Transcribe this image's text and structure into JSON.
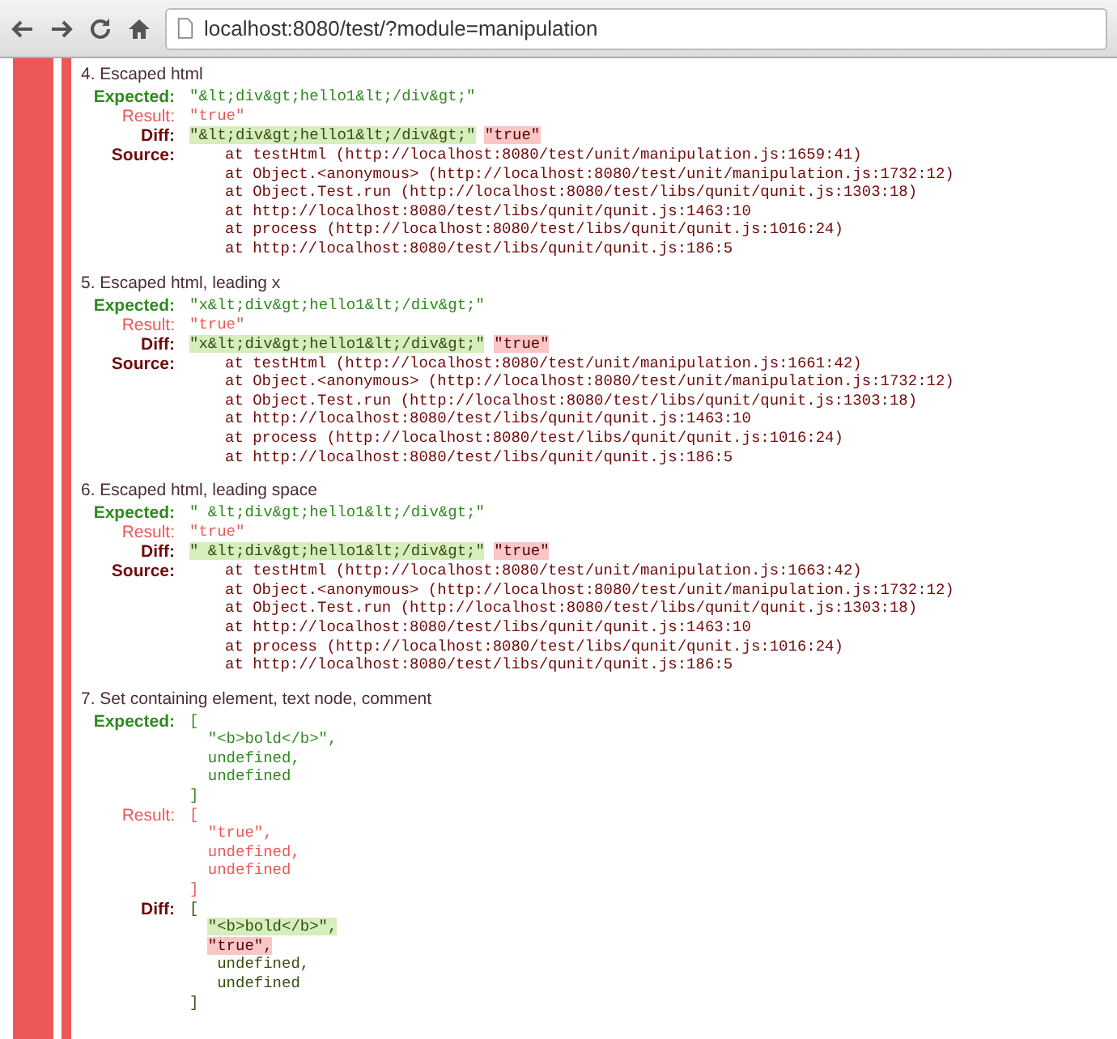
{
  "browser": {
    "url": "localhost:8080/test/?module=manipulation"
  },
  "module": {
    "failed": true
  },
  "tests": [
    {
      "title": "4. Escaped html",
      "rows": [
        {
          "kind": "expected",
          "label": "Expected:",
          "lines": [
            "\"&lt;div&gt;hello1&lt;/div&gt;\""
          ]
        },
        {
          "kind": "result",
          "label": "Result:",
          "lines": [
            "\"true\""
          ]
        },
        {
          "kind": "diff",
          "label": "Diff:",
          "diff": [
            [
              {
                "kind": "ins",
                "text": "\"&lt;div&gt;hello1&lt;/div&gt;\""
              },
              {
                "kind": "del",
                "text": "\"true\""
              }
            ]
          ]
        },
        {
          "kind": "source",
          "label": "Source:",
          "lines": [
            "at testHtml (http://localhost:8080/test/unit/manipulation.js:1659:41)",
            "at Object.<anonymous> (http://localhost:8080/test/unit/manipulation.js:1732:12)",
            "at Object.Test.run (http://localhost:8080/test/libs/qunit/qunit.js:1303:18)",
            "at http://localhost:8080/test/libs/qunit/qunit.js:1463:10",
            "at process (http://localhost:8080/test/libs/qunit/qunit.js:1016:24)",
            "at http://localhost:8080/test/libs/qunit/qunit.js:186:5"
          ]
        }
      ]
    },
    {
      "title": "5. Escaped html, leading x",
      "rows": [
        {
          "kind": "expected",
          "label": "Expected:",
          "lines": [
            "\"x&lt;div&gt;hello1&lt;/div&gt;\""
          ]
        },
        {
          "kind": "result",
          "label": "Result:",
          "lines": [
            "\"true\""
          ]
        },
        {
          "kind": "diff",
          "label": "Diff:",
          "diff": [
            [
              {
                "kind": "ins",
                "text": "\"x&lt;div&gt;hello1&lt;/div&gt;\""
              },
              {
                "kind": "del",
                "text": "\"true\""
              }
            ]
          ]
        },
        {
          "kind": "source",
          "label": "Source:",
          "lines": [
            "at testHtml (http://localhost:8080/test/unit/manipulation.js:1661:42)",
            "at Object.<anonymous> (http://localhost:8080/test/unit/manipulation.js:1732:12)",
            "at Object.Test.run (http://localhost:8080/test/libs/qunit/qunit.js:1303:18)",
            "at http://localhost:8080/test/libs/qunit/qunit.js:1463:10",
            "at process (http://localhost:8080/test/libs/qunit/qunit.js:1016:24)",
            "at http://localhost:8080/test/libs/qunit/qunit.js:186:5"
          ]
        }
      ]
    },
    {
      "title": "6. Escaped html, leading space",
      "rows": [
        {
          "kind": "expected",
          "label": "Expected:",
          "lines": [
            "\" &lt;div&gt;hello1&lt;/div&gt;\""
          ]
        },
        {
          "kind": "result",
          "label": "Result:",
          "lines": [
            "\"true\""
          ]
        },
        {
          "kind": "diff",
          "label": "Diff:",
          "diff": [
            [
              {
                "kind": "ins",
                "text": "\" &lt;div&gt;hello1&lt;/div&gt;\""
              },
              {
                "kind": "del",
                "text": "\"true\""
              }
            ]
          ]
        },
        {
          "kind": "source",
          "label": "Source:",
          "lines": [
            "at testHtml (http://localhost:8080/test/unit/manipulation.js:1663:42)",
            "at Object.<anonymous> (http://localhost:8080/test/unit/manipulation.js:1732:12)",
            "at Object.Test.run (http://localhost:8080/test/libs/qunit/qunit.js:1303:18)",
            "at http://localhost:8080/test/libs/qunit/qunit.js:1463:10",
            "at process (http://localhost:8080/test/libs/qunit/qunit.js:1016:24)",
            "at http://localhost:8080/test/libs/qunit/qunit.js:186:5"
          ]
        }
      ]
    },
    {
      "title": "7. Set containing element, text node, comment",
      "rows": [
        {
          "kind": "expected",
          "label": "Expected:",
          "lines": [
            "[",
            "\"<b>bold</b>\",",
            "undefined,",
            "undefined",
            "]"
          ]
        },
        {
          "kind": "result",
          "label": "Result:",
          "lines": [
            "[",
            "\"true\",",
            "undefined,",
            "undefined",
            "]"
          ]
        },
        {
          "kind": "diff",
          "label": "Diff:",
          "diff": [
            [
              {
                "kind": "plain",
                "text": "["
              }
            ],
            [
              {
                "kind": "ins",
                "text": "\"<b>bold</b>\","
              }
            ],
            [
              {
                "kind": "del",
                "text": "\"true\","
              }
            ],
            [
              {
                "kind": "plain",
                "text": " undefined,"
              }
            ],
            [
              {
                "kind": "plain",
                "text": " undefined"
              }
            ],
            [
              {
                "kind": "plain",
                "text": "]"
              }
            ]
          ]
        }
      ]
    }
  ]
}
